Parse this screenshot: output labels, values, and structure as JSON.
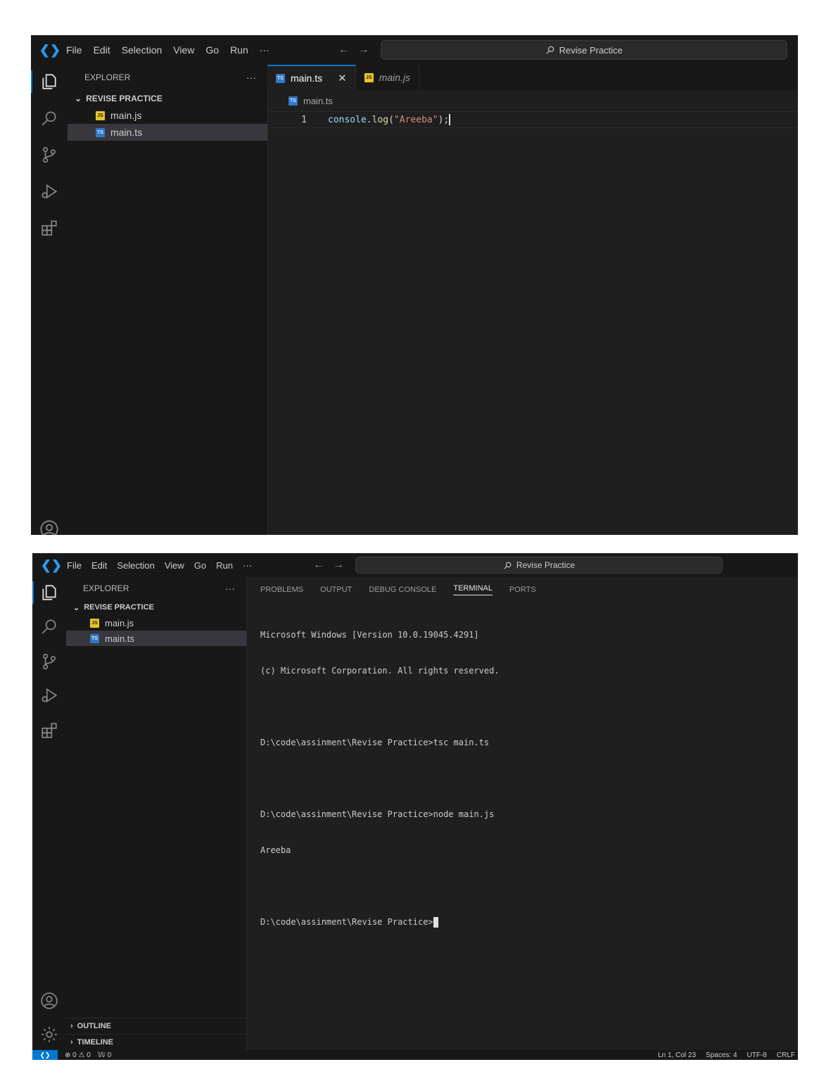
{
  "menu": [
    "File",
    "Edit",
    "Selection",
    "View",
    "Go",
    "Run",
    "···"
  ],
  "search": {
    "text": "Revise Practice"
  },
  "explorer": {
    "title": "EXPLORER",
    "more": "···",
    "folder": "REVISE PRACTICE",
    "files": [
      {
        "name": "main.js",
        "type": "js",
        "selected": false
      },
      {
        "name": "main.ts",
        "type": "ts",
        "selected": true
      }
    ],
    "sections": [
      "OUTLINE",
      "TIMELINE"
    ]
  },
  "editor": {
    "tabs": [
      {
        "label": "main.ts",
        "active": true,
        "close": "✕"
      },
      {
        "label": "main.js",
        "active": false
      }
    ],
    "breadcrumb": "main.ts",
    "lines": [
      {
        "number": "1",
        "tokens": {
          "obj": "console",
          "dot": ".",
          "fn": "log",
          "open": "(",
          "str": "\"Areeba\"",
          "close": ");"
        }
      }
    ]
  },
  "panel": {
    "tabs": [
      "PROBLEMS",
      "OUTPUT",
      "DEBUG CONSOLE",
      "TERMINAL",
      "PORTS"
    ],
    "active_tab": "TERMINAL",
    "terminal_lines": [
      "Microsoft Windows [Version 10.0.19045.4291]",
      "(c) Microsoft Corporation. All rights reserved.",
      "",
      "D:\\code\\assinment\\Revise Practice>tsc main.ts",
      "",
      "D:\\code\\assinment\\Revise Practice>node main.js",
      "Areeba",
      "",
      "D:\\code\\assinment\\Revise Practice>"
    ]
  },
  "statusbar": {
    "left": [
      "⊗ 0 ⚠ 0",
      "𝕎 0"
    ],
    "right": [
      "Ln 1, Col 23",
      "Spaces: 4",
      "UTF-8",
      "CRLF"
    ]
  },
  "colors": {
    "accent": "#0078d4",
    "js_icon": "#e8c52a",
    "ts_icon": "#3178c6",
    "string": "#ce9178"
  },
  "icons": [
    "vscode-logo-icon",
    "explorer-icon",
    "search-icon",
    "source-control-icon",
    "run-debug-icon",
    "extensions-icon",
    "account-icon",
    "settings-gear-icon",
    "close-icon",
    "chevron-down-icon",
    "chevron-right-icon"
  ]
}
